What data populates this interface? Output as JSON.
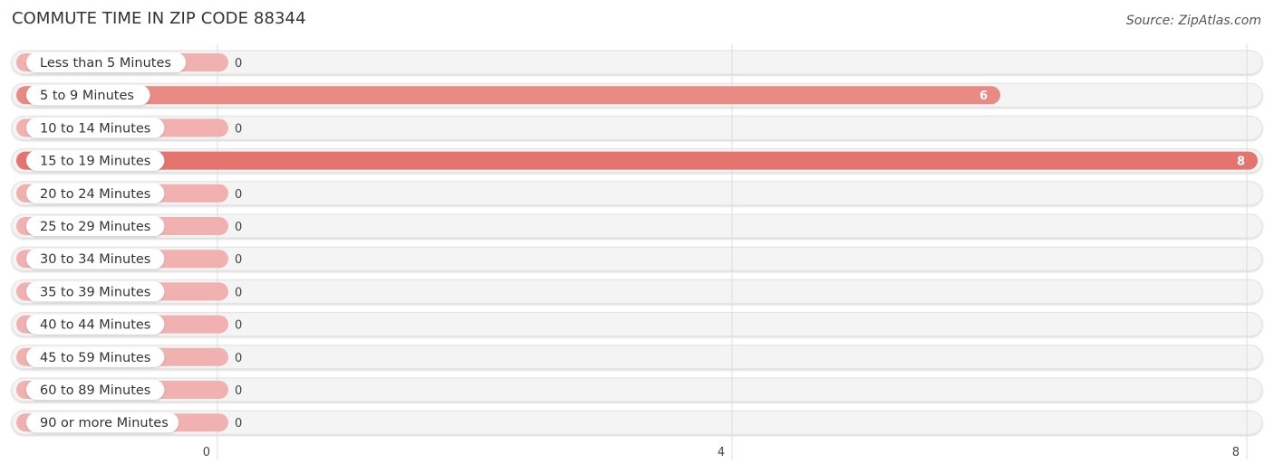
{
  "header": {
    "title": "COMMUTE TIME IN ZIP CODE 88344",
    "source": "Source: ZipAtlas.com"
  },
  "colors": {
    "bar_strong": "#e5736e",
    "bar_mid": "#e98a84",
    "bar_light": "#f0b1b0",
    "track": "#f4f4f4",
    "grid": "#dddddd"
  },
  "chart_data": {
    "type": "bar",
    "orientation": "horizontal",
    "title": "COMMUTE TIME IN ZIP CODE 88344",
    "xlabel": "",
    "ylabel": "",
    "xlim": [
      0,
      8
    ],
    "x_ticks": [
      0,
      4,
      8
    ],
    "grid": true,
    "categories": [
      "Less than 5 Minutes",
      "5 to 9 Minutes",
      "10 to 14 Minutes",
      "15 to 19 Minutes",
      "20 to 24 Minutes",
      "25 to 29 Minutes",
      "30 to 34 Minutes",
      "35 to 39 Minutes",
      "40 to 44 Minutes",
      "45 to 59 Minutes",
      "60 to 89 Minutes",
      "90 or more Minutes"
    ],
    "values": [
      0,
      6,
      0,
      8,
      0,
      0,
      0,
      0,
      0,
      0,
      0,
      0
    ]
  }
}
